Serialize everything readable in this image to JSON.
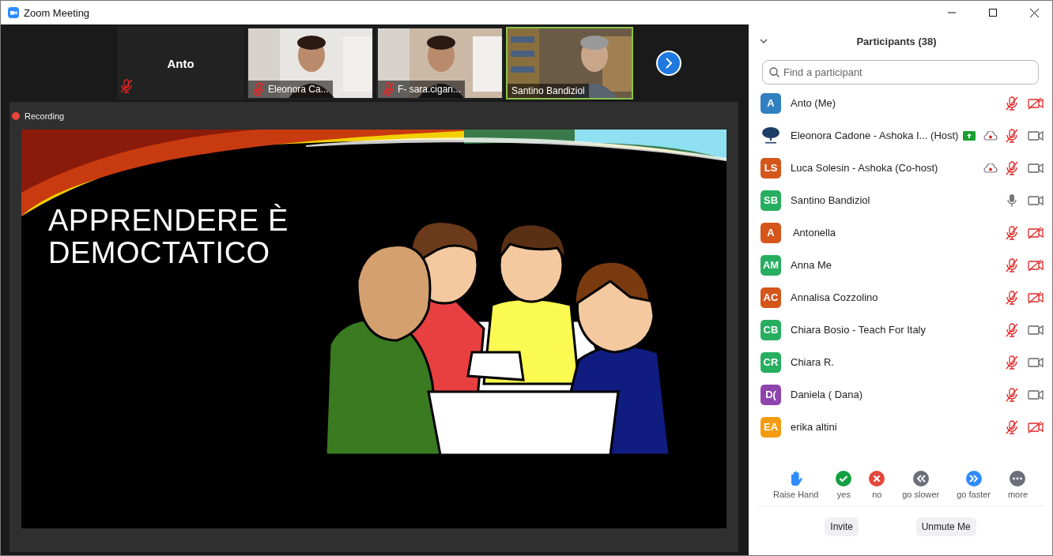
{
  "window": {
    "title": "Zoom Meeting"
  },
  "video_strip": {
    "tiles": [
      {
        "kind": "name",
        "name": "Anto",
        "muted": true,
        "speaking": false
      },
      {
        "kind": "video",
        "caption": "Eleonora Ca...",
        "muted": true,
        "speaking": false
      },
      {
        "kind": "video",
        "caption": "F- sara.cigan...",
        "muted": true,
        "speaking": false
      },
      {
        "kind": "video",
        "caption": "Santino Bandiziol",
        "muted": false,
        "speaking": true
      }
    ]
  },
  "share": {
    "recording_label": "Recording",
    "slide_title": "APPRENDERE È DEMOCTATICO"
  },
  "participants_panel": {
    "title": "Participants (38)",
    "search": {
      "placeholder": "Find a participant"
    },
    "participants": [
      {
        "name": "Anto (Me)",
        "kind": "initials",
        "initials": "A",
        "color": "#2f7fc1",
        "sharing": false,
        "recording": false,
        "muted": true,
        "video_on": false
      },
      {
        "name": "Eleonora Cadone - Ashoka I... (Host)",
        "kind": "logo",
        "sharing": true,
        "recording": true,
        "muted": true,
        "video_on": true
      },
      {
        "name": "Luca Solesin - Ashoka (Co-host)",
        "kind": "initials",
        "initials": "LS",
        "color": "#d4561a",
        "sharing": false,
        "recording": true,
        "muted": true,
        "video_on": true
      },
      {
        "name": "Santino Bandiziol",
        "kind": "initials",
        "initials": "SB",
        "color": "#27ae60",
        "sharing": false,
        "recording": false,
        "muted": false,
        "video_on": true
      },
      {
        "name": " Antonella",
        "kind": "initials",
        "initials": "A",
        "color": "#d4561a",
        "sharing": false,
        "recording": false,
        "muted": true,
        "video_on": false
      },
      {
        "name": "Anna Me",
        "kind": "initials",
        "initials": "AM",
        "color": "#27ae60",
        "sharing": false,
        "recording": false,
        "muted": true,
        "video_on": false
      },
      {
        "name": "Annalisa Cozzolino",
        "kind": "initials",
        "initials": "AC",
        "color": "#d4561a",
        "sharing": false,
        "recording": false,
        "muted": true,
        "video_on": false
      },
      {
        "name": "Chiara Bosio - Teach For Italy",
        "kind": "initials",
        "initials": "CB",
        "color": "#27ae60",
        "sharing": false,
        "recording": false,
        "muted": true,
        "video_on": true
      },
      {
        "name": "Chiara R.",
        "kind": "initials",
        "initials": "CR",
        "color": "#27ae60",
        "sharing": false,
        "recording": false,
        "muted": true,
        "video_on": true
      },
      {
        "name": "Daniela ( Dana)",
        "kind": "initials",
        "initials": "D(",
        "color": "#8e44ad",
        "sharing": false,
        "recording": false,
        "muted": true,
        "video_on": true
      },
      {
        "name": "erika altini",
        "kind": "initials",
        "initials": "EA",
        "color": "#f39c12",
        "sharing": false,
        "recording": false,
        "muted": true,
        "video_on": false
      }
    ],
    "reactions": [
      {
        "kind": "hand",
        "label": "Raise Hand"
      },
      {
        "kind": "yes",
        "label": "yes"
      },
      {
        "kind": "no",
        "label": "no"
      },
      {
        "kind": "slower",
        "label": "go slower"
      },
      {
        "kind": "faster",
        "label": "go faster"
      },
      {
        "kind": "more",
        "label": "more"
      }
    ],
    "buttons": [
      "Invite",
      "Unmute Me"
    ]
  }
}
